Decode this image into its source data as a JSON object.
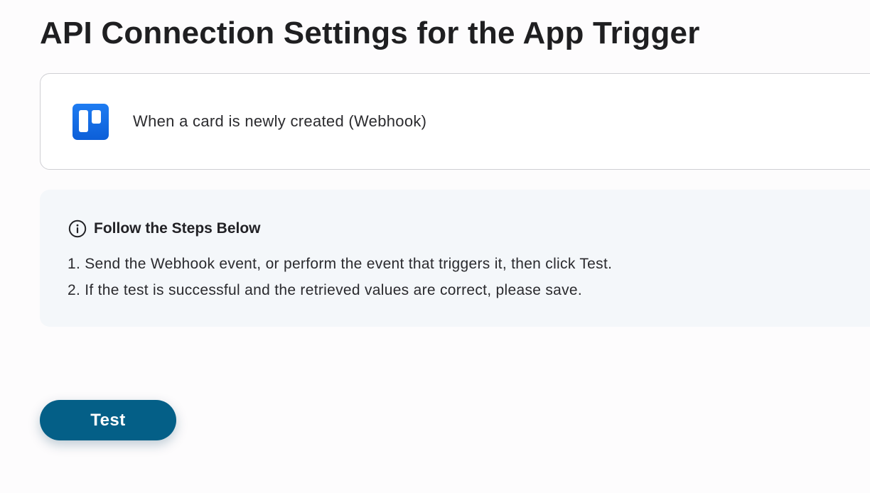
{
  "page": {
    "title": "API Connection Settings for the App Trigger"
  },
  "trigger": {
    "app_icon": "trello-icon",
    "label": "When a card is newly created (Webhook)"
  },
  "steps": {
    "icon": "info-circle-icon",
    "heading": "Follow the Steps Below",
    "items": [
      "1. Send the Webhook event, or perform the event that triggers it, then click Test.",
      "2. If the test is successful and the retrieved values are correct, please save."
    ]
  },
  "actions": {
    "test_label": "Test"
  },
  "colors": {
    "accent": "#045f87",
    "app_icon": "#0c66e4",
    "panel_bg": "#f4f7fa"
  }
}
